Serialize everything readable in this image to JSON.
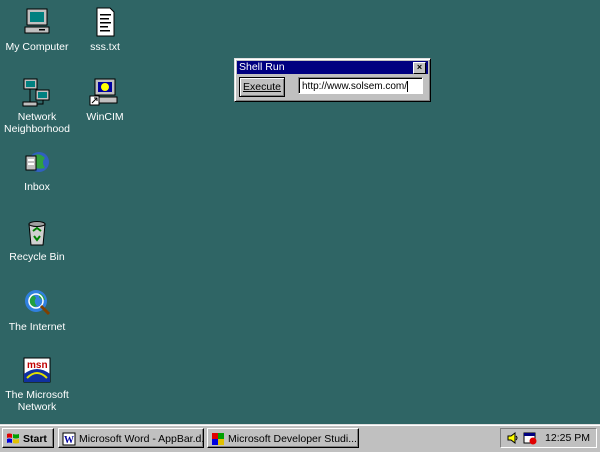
{
  "desktop": {
    "icons": [
      {
        "name": "my-computer-icon",
        "label": "My Computer"
      },
      {
        "name": "sss-txt-icon",
        "label": "sss.txt"
      },
      {
        "name": "network-neighborhood-icon",
        "label": "Network Neighborhood"
      },
      {
        "name": "wincim-icon",
        "label": "WinCIM"
      },
      {
        "name": "inbox-icon",
        "label": "Inbox"
      },
      {
        "name": "recycle-bin-icon",
        "label": "Recycle Bin"
      },
      {
        "name": "the-internet-icon",
        "label": "The Internet"
      },
      {
        "name": "msn-icon",
        "label": "The Microsoft Network"
      }
    ],
    "background_color": "#2f6565"
  },
  "shell_run": {
    "title": "Shell Run",
    "execute_label": "Execute",
    "url_value": "http://www.solsem.com/"
  },
  "taskbar": {
    "start_label": "Start",
    "tasks": [
      {
        "label": "Microsoft Word - AppBar.d..."
      },
      {
        "label": "Microsoft Developer Studi..."
      }
    ],
    "clock": "12:25 PM"
  }
}
